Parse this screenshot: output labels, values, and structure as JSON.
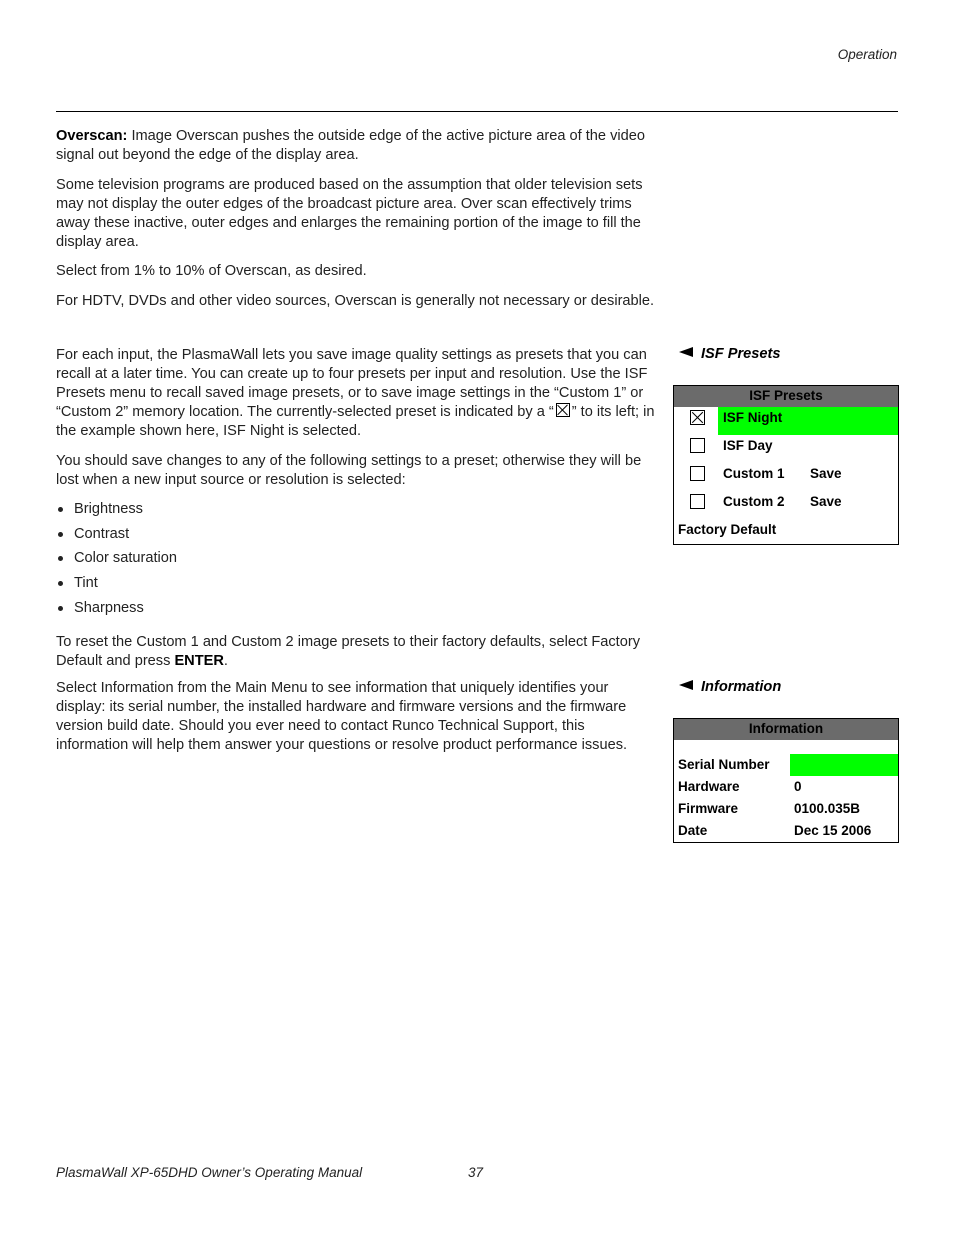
{
  "header": {
    "section": "Operation"
  },
  "overscan": {
    "label": "Overscan:",
    "intro": " Image Overscan pushes the outside edge of the active picture area of the video signal out beyond the edge of the display area.",
    "p2": "Some television programs are produced based on the assumption that older television sets may not display the outer edges of the broadcast picture area. Over scan effectively trims away these inactive, outer edges and enlarges the remaining portion of the image to fill the display area.",
    "p3": "Select from 1% to 10% of Overscan, as desired.",
    "p4": "For HDTV, DVDs and other video sources, Overscan is generally not necessary or desirable."
  },
  "isf_presets": {
    "heading": "ISF Presets",
    "p1_before": "For each input, the PlasmaWall lets you save image quality settings as presets that you can recall at a later time. You can create up to four presets per input and resolution. Use the ISF Presets menu to recall saved image presets, or to save image settings in the “Custom 1” or “Custom 2” memory location. The currently-selected preset is indicated by a “",
    "p1_after": "” to its left; in the example shown here, ISF Night is selected.",
    "p2": "You should save changes to any of the following settings to a preset; otherwise they will be lost when a new input source or resolution is selected:",
    "bullets": [
      "Brightness",
      "Contrast",
      "Color saturation",
      "Tint",
      "Sharpness"
    ],
    "p3_before": "To reset the Custom 1 and Custom 2 image presets to their factory defaults, select Factory Default and press ",
    "p3_bold": "ENTER",
    "p3_after": ".",
    "menu": {
      "title": "ISF Presets",
      "rows": [
        {
          "name": "ISF Night",
          "checked": true,
          "highlighted": true,
          "action": ""
        },
        {
          "name": "ISF Day",
          "checked": false,
          "highlighted": false,
          "action": ""
        },
        {
          "name": "Custom 1",
          "checked": false,
          "highlighted": false,
          "action": "Save"
        },
        {
          "name": "Custom 2",
          "checked": false,
          "highlighted": false,
          "action": "Save"
        }
      ],
      "footer_item": "Factory Default",
      "highlight_color": "#00ff00",
      "title_bg": "#6b6b6b"
    }
  },
  "information": {
    "heading": "Information",
    "p1": "Select Information from the Main Menu to see information that uniquely identifies your display: its serial number, the installed hardware and firmware versions and the firmware version build date. Should you ever need to contact Runco Technical Support, this information will help them answer your questions or resolve product performance issues.",
    "menu": {
      "title": "Information",
      "rows": [
        {
          "label": "Serial Number",
          "value": "",
          "highlighted": true
        },
        {
          "label": "Hardware",
          "value": "0",
          "highlighted": false
        },
        {
          "label": "Firmware",
          "value": "0100.035B",
          "highlighted": false
        },
        {
          "label": "Date",
          "value": "Dec 15 2006",
          "highlighted": false
        }
      ]
    }
  },
  "footer": {
    "title": "PlasmaWall XP-65DHD Owner’s Operating Manual",
    "page_number": "37"
  }
}
